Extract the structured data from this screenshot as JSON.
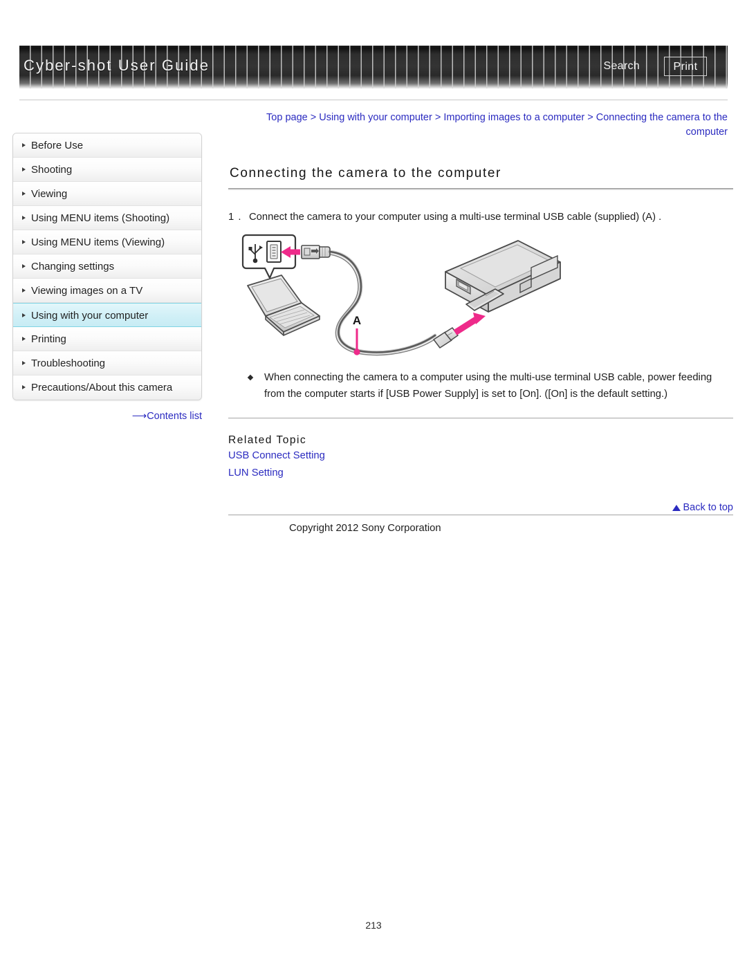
{
  "header": {
    "title": "Cyber-shot User Guide",
    "search_label": "Search",
    "print_label": "Print"
  },
  "breadcrumb": {
    "text": "Top page > Using with your computer > Importing images to a computer > Connecting the camera to the computer"
  },
  "sidebar": {
    "items": [
      {
        "label": "Before Use",
        "active": false
      },
      {
        "label": "Shooting",
        "active": false
      },
      {
        "label": "Viewing",
        "active": false
      },
      {
        "label": "Using MENU items (Shooting)",
        "active": false
      },
      {
        "label": "Using MENU items (Viewing)",
        "active": false
      },
      {
        "label": "Changing settings",
        "active": false
      },
      {
        "label": "Viewing images on a TV",
        "active": false
      },
      {
        "label": "Using with your computer",
        "active": true
      },
      {
        "label": "Printing",
        "active": false
      },
      {
        "label": "Troubleshooting",
        "active": false
      },
      {
        "label": "Precautions/About this camera",
        "active": false
      }
    ],
    "contents_list_label": "Contents list",
    "contents_list_arrow": "⟶"
  },
  "main": {
    "title": "Connecting the camera to the computer",
    "step_number": "1 .",
    "step_text": "Connect the camera to your computer using a multi-use terminal USB cable (supplied) (A) .",
    "figure": {
      "callout_label": "A",
      "usb_symbol": "USB trident icon",
      "arrow_color": "#ee2a8a",
      "line_color": "#4d4d4d"
    },
    "notes": [
      "When connecting the camera to a computer using the multi-use terminal USB cable, power feeding from the computer starts if [USB Power Supply] is set to [On]. ([On] is the default setting.)"
    ],
    "related_topic_heading": "Related Topic",
    "related_links": [
      "USB Connect Setting",
      "LUN Setting"
    ],
    "back_to_top_label": "Back to top",
    "copyright": "Copyright 2012 Sony Corporation"
  },
  "page_number": "213",
  "colors": {
    "link": "#2b2bc0",
    "active_nav": "#d2f0f7",
    "accent_magenta": "#ee2a8a"
  }
}
